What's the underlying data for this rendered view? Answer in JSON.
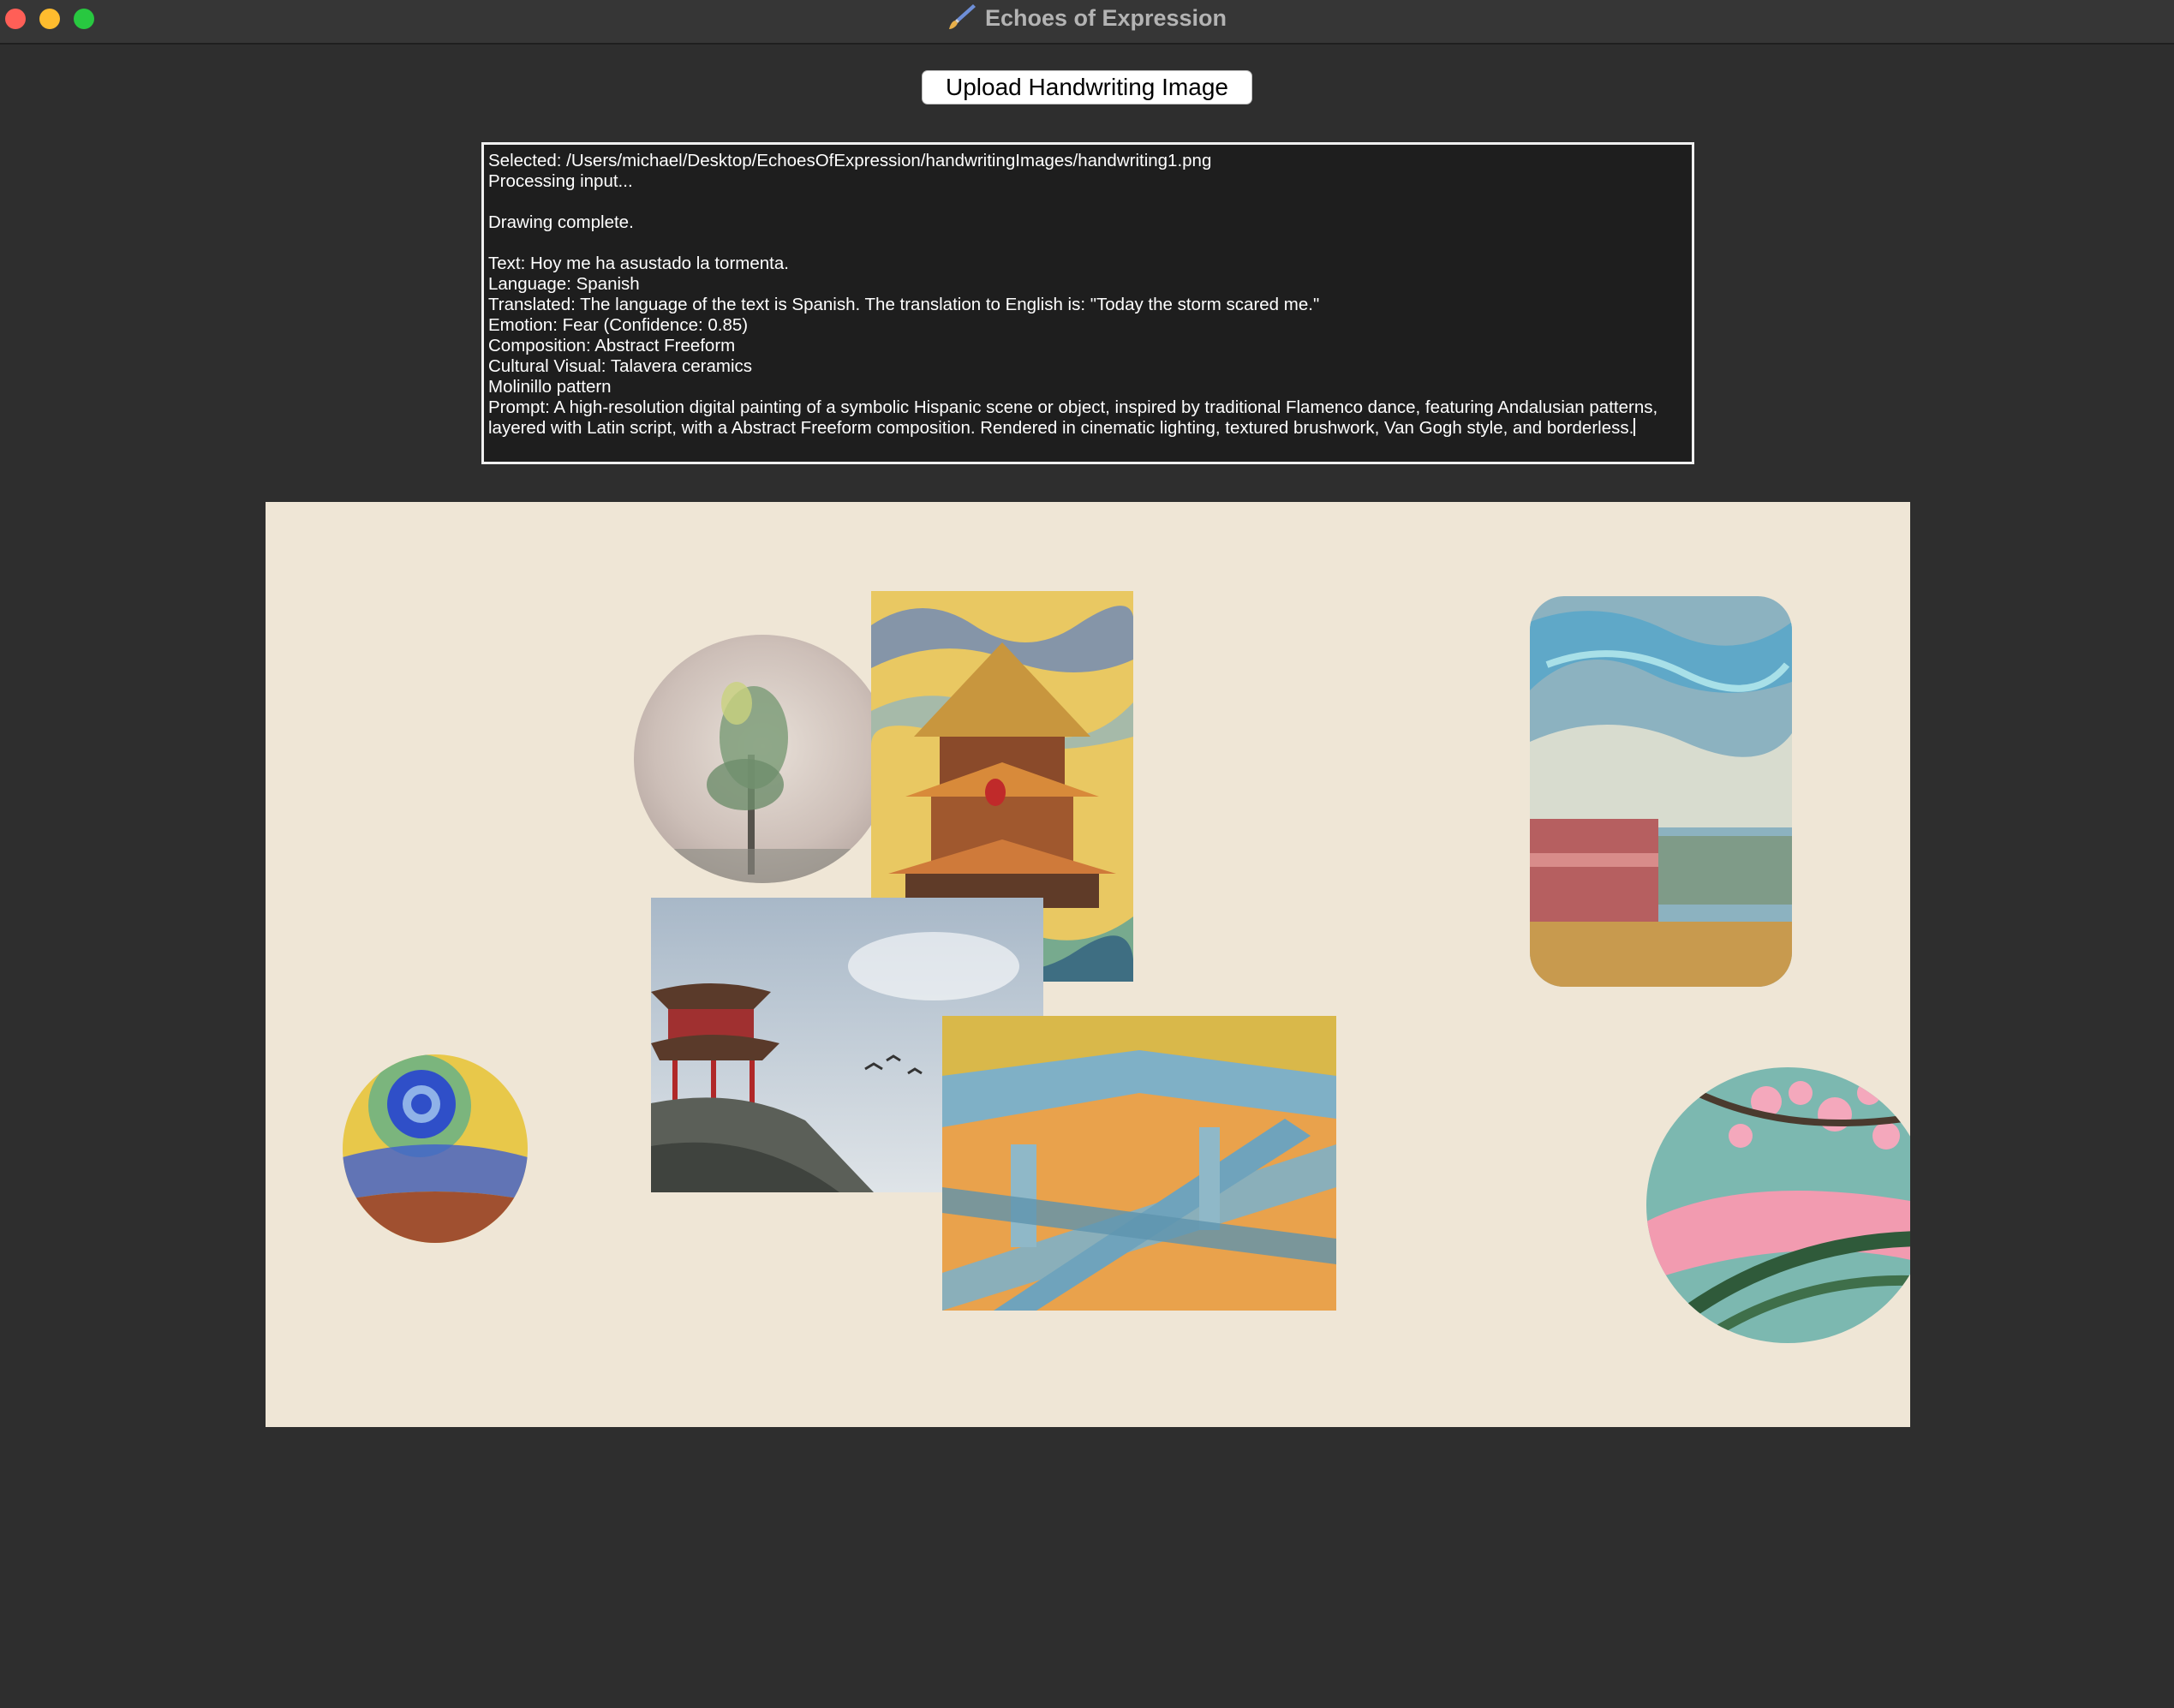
{
  "window": {
    "title": "Echoes of Expression"
  },
  "toolbar": {
    "upload_label": "Upload Handwriting Image"
  },
  "log": {
    "lines": [
      "Selected: /Users/michael/Desktop/EchoesOfExpression/handwritingImages/handwriting1.png",
      "Processing input...",
      "",
      "Drawing complete.",
      "",
      "Text: Hoy me ha asustado la tormenta.",
      "Language: Spanish",
      "Translated: The language of the text is Spanish. The translation to English is: \"Today the storm scared me.\"",
      "Emotion: Fear (Confidence: 0.85)",
      "Composition: Abstract Freeform",
      "Cultural Visual: Talavera ceramics",
      "Molinillo pattern"
    ],
    "prompt": "Prompt: A high-resolution digital painting of a symbolic Hispanic scene or object, inspired by traditional Flamenco dance, featuring Andalusian patterns, layered with Latin script, with a Abstract Freeform composition. Rendered in cinematic lighting, textured brushwork, Van Gogh style, and borderless."
  },
  "icons": {
    "title_icon": "paintbrush-icon"
  },
  "colors": {
    "background": "#2e2e2e",
    "canvas": "#efe6d6",
    "close": "#ff5f57",
    "minimize": "#febc2e",
    "maximize": "#28c840"
  }
}
